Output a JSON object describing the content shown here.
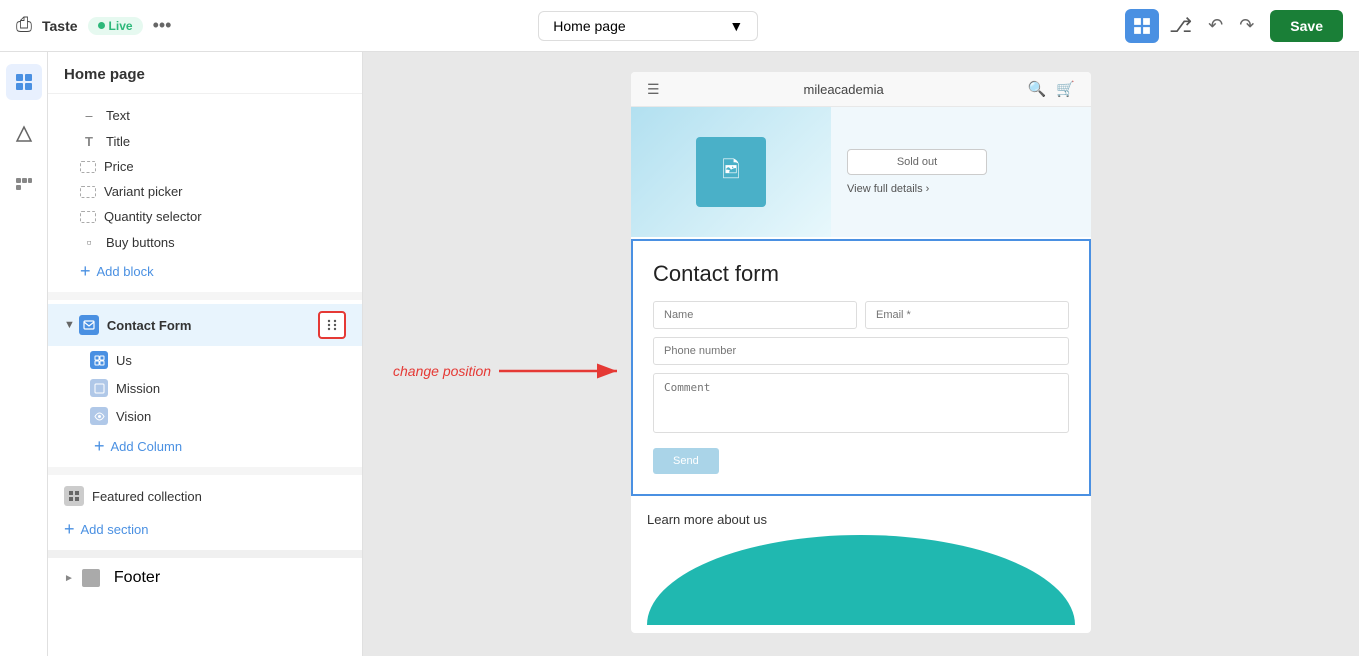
{
  "topbar": {
    "site_name": "Taste",
    "live_label": "Live",
    "more_icon": "•••",
    "page_selector_value": "Home page",
    "save_label": "Save"
  },
  "sidebar": {
    "section_title": "Home page",
    "tree_items": [
      {
        "label": "Text",
        "icon": "T",
        "indent": 1
      },
      {
        "label": "Title",
        "icon": "T",
        "indent": 1
      },
      {
        "label": "Price",
        "icon": "◻",
        "indent": 1
      },
      {
        "label": "Variant picker",
        "icon": "◻",
        "indent": 1
      },
      {
        "label": "Quantity selector",
        "icon": "◻",
        "indent": 1
      },
      {
        "label": "Buy buttons",
        "icon": "⊞",
        "indent": 1
      }
    ],
    "add_block_label": "Add block",
    "contact_form_label": "Contact Form",
    "sub_items": [
      {
        "label": "Us",
        "icon_type": "blue"
      },
      {
        "label": "Mission",
        "icon_type": "light"
      },
      {
        "label": "Vision",
        "icon_type": "light"
      }
    ],
    "add_column_label": "Add Column",
    "featured_collection_label": "Featured collection",
    "add_section_label": "Add section",
    "footer_label": "Footer"
  },
  "annotation": {
    "text": "change position",
    "arrow": "→"
  },
  "preview": {
    "site_title": "mileacademia",
    "product": {
      "sold_out_label": "Sold out",
      "view_details_label": "View full details  ›"
    },
    "contact_form": {
      "title": "Contact form",
      "name_placeholder": "Name",
      "email_placeholder": "Email *",
      "phone_placeholder": "Phone number",
      "comment_placeholder": "Comment",
      "submit_label": "Send"
    },
    "learn_more": {
      "title": "Learn more about us"
    }
  }
}
